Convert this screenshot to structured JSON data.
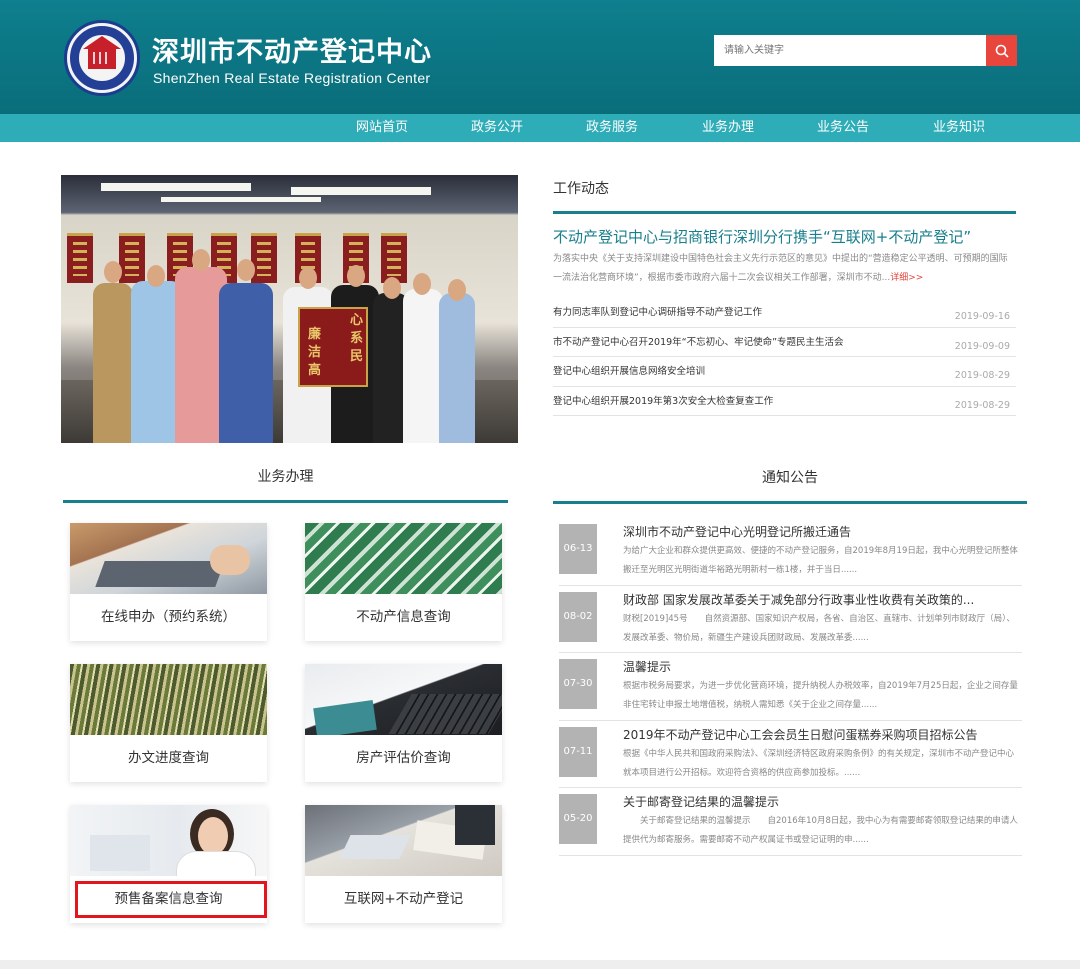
{
  "header": {
    "title": "深圳市不动产登记中心",
    "subtitle": "ShenZhen Real Estate Registration Center",
    "logo_icon": "real-estate-registration-seal",
    "search_placeholder": "请输入关键字",
    "search_icon": "search-icon",
    "colors": {
      "header_bg": "#0a7483",
      "nav_bg": "#2eadb8",
      "accent": "#187f8c",
      "search_button": "#e8453c"
    }
  },
  "nav": {
    "items": [
      "网站首页",
      "政务公开",
      "政务服务",
      "业务办理",
      "业务公告",
      "业务知识"
    ]
  },
  "news": {
    "title": "工作动态",
    "headline": "不动产登记中心与招商银行深圳分行携手“互联网+不动产登记”",
    "summary": "为落实中央《关于支持深圳建设中国特色社会主义先行示范区的意见》中提出的“营造稳定公平透明、可预期的国际一流法治化营商环境”，根据市委市政府六届十二次会议相关工作部署，深圳市不动...",
    "more": "详细>>",
    "items": [
      {
        "title": "有力同志率队到登记中心调研指导不动产登记工作",
        "date": "2019-09-16"
      },
      {
        "title": "市不动产登记中心召开2019年“不忘初心、牢记使命”专题民主生活会",
        "date": "2019-09-09"
      },
      {
        "title": "登记中心组织开展信息网络安全培训",
        "date": "2019-08-29"
      },
      {
        "title": "登记中心组织开展2019年第3次安全大检查复查工作",
        "date": "2019-08-29"
      }
    ]
  },
  "business": {
    "title": "业务办理",
    "tiles": [
      {
        "label": "在线申办（预约系统）",
        "icon": "laptop-typing-photo"
      },
      {
        "label": "不动产信息查询",
        "icon": "building-facade-photo"
      },
      {
        "label": "办文进度查询",
        "icon": "file-folders-photo"
      },
      {
        "label": "房产评估价查询",
        "icon": "laptop-keyboard-photo"
      },
      {
        "label": "预售备案信息查询",
        "icon": "woman-smiling-photo"
      },
      {
        "label": "互联网+不动产登记",
        "icon": "business-meeting-photo"
      }
    ]
  },
  "notices": {
    "title": "通知公告",
    "items": [
      {
        "date": "06-13",
        "title": "深圳市不动产登记中心光明登记所搬迁通告",
        "summary": "为给广大企业和群众提供更高效、便捷的不动产登记服务，自2019年8月19日起，我中心光明登记所整体搬迁至光明区光明街道华裕路光明新村一栋1楼，并于当日......"
      },
      {
        "date": "08-02",
        "title": "财政部 国家发展改革委关于减免部分行政事业性收费有关政策的...",
        "summary": "财税[2019]45号　　自然资源部、国家知识产权局，各省、自治区、直辖市、计划单列市财政厅（局）、发展改革委、物价局，新疆生产建设兵团财政局、发展改革委......"
      },
      {
        "date": "07-30",
        "title": "温馨提示",
        "summary": "根据市税务局要求，为进一步优化营商环境，提升纳税人办税效率，自2019年7月25日起，企业之间存量非住宅转让申报土地增值税，纳税人需知悉《关于企业之间存量......"
      },
      {
        "date": "07-11",
        "title": "2019年不动产登记中心工会会员生日慰问蛋糕券采购项目招标公告",
        "summary": "根据《中华人民共和国政府采购法》、《深圳经济特区政府采购条例》的有关规定，深圳市不动产登记中心就本项目进行公开招标。欢迎符合资格的供应商参加投标。......"
      },
      {
        "date": "05-20",
        "title": "关于邮寄登记结果的温馨提示",
        "summary": "　　关于邮寄登记结果的温馨提示　　自2016年10月8日起，我中心为有需要邮寄领取登记结果的申请人提供代为邮寄服务。需要邮寄不动产权属证书或登记证明的申......"
      }
    ]
  },
  "photo": {
    "pennant_text": [
      "心",
      "系",
      "民",
      "廉",
      "洁",
      "高"
    ]
  }
}
